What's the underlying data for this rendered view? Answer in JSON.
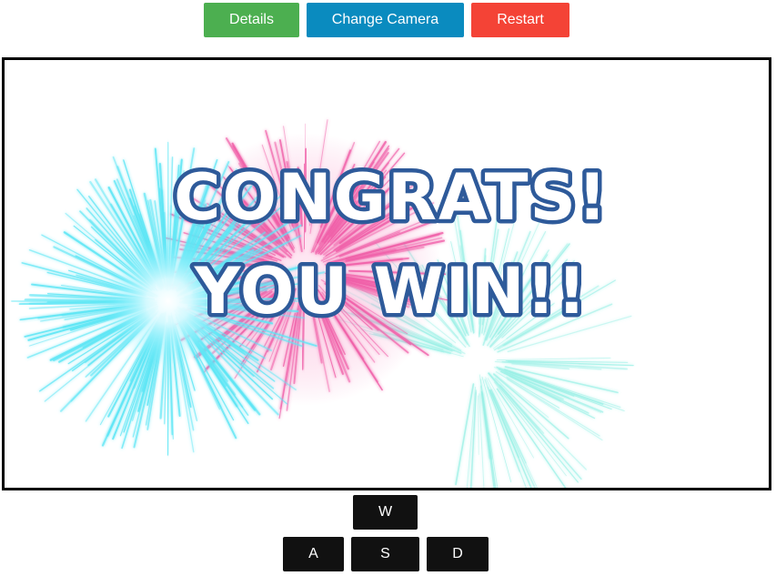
{
  "toolbar": {
    "details_label": "Details",
    "camera_label": "Change Camera",
    "restart_label": "Restart",
    "details_color": "#4caf50",
    "camera_color": "#0a8bbf",
    "restart_color": "#f44336"
  },
  "game": {
    "message_line1": "CONGRATS!",
    "message_line2": "YOU WIN!!",
    "text_color": "#2e5a9a",
    "firework_colors": [
      "#5ee6f5",
      "#f05fa8",
      "#9af0e6"
    ]
  },
  "controls": {
    "up_label": "W",
    "left_label": "A",
    "down_label": "S",
    "right_label": "D"
  }
}
